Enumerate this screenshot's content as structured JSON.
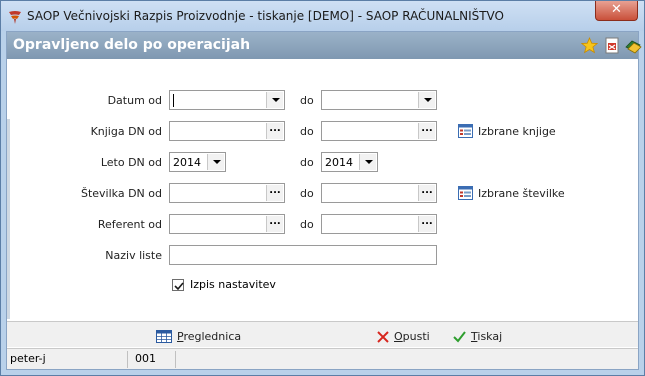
{
  "window": {
    "title": "SAOP  Večnivojski Razpis Proizvodnje - tiskanje [DEMO] - SAOP RAČUNALNIŠTVO",
    "close_label": "✕"
  },
  "header": {
    "title": "Opravljeno delo po operacijah",
    "icons": [
      "star-icon",
      "pdf-icon",
      "books-icon"
    ]
  },
  "form": {
    "do_label": "do",
    "datum": {
      "label": "Datum od",
      "from_value": "",
      "to_value": ""
    },
    "knjiga": {
      "label": "Knjiga DN od",
      "from_value": "",
      "to_value": "",
      "link": "Izbrane knjige"
    },
    "leto": {
      "label": "Leto DN od",
      "from_value": "2014",
      "to_value": "2014"
    },
    "stevilka": {
      "label": "Številka DN od",
      "from_value": "",
      "to_value": "",
      "link": "Izbrane številke"
    },
    "referent": {
      "label": "Referent od",
      "from_value": "",
      "to_value": ""
    },
    "naziv": {
      "label": "Naziv liste",
      "value": ""
    },
    "izpis": {
      "label": "Izpis nastavitev",
      "checked": true
    }
  },
  "buttons": {
    "preglednica": {
      "hot": "P",
      "rest": "reglednica"
    },
    "opusti": {
      "hot": "O",
      "rest": "pusti"
    },
    "tiskaj": {
      "hot": "T",
      "rest": "iskaj"
    }
  },
  "status": {
    "user": "peter-j",
    "code": "001"
  }
}
